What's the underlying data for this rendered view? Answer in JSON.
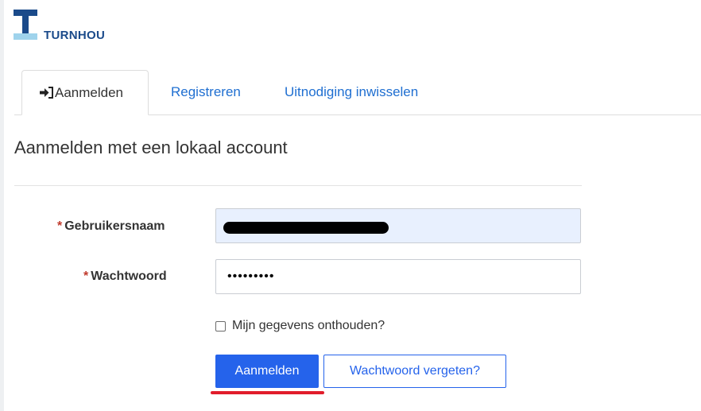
{
  "header": {
    "logo_text": "TURNHOU"
  },
  "tabs": [
    {
      "label": "Aanmelden",
      "icon": "sign-in-icon",
      "active": true
    },
    {
      "label": "Registreren",
      "active": false
    },
    {
      "label": "Uitnodiging inwisselen",
      "active": false
    }
  ],
  "form": {
    "title": "Aanmelden met een lokaal account",
    "required_marker": "*",
    "username_label": "Gebruikersnaam",
    "username_value": "",
    "password_label": "Wachtwoord",
    "password_value": "•••••••••",
    "remember_label": "Mijn gegevens onthouden?",
    "remember_checked": false,
    "submit_label": "Aanmelden",
    "forgot_label": "Wachtwoord vergeten?"
  },
  "colors": {
    "accent": "#2563eb",
    "link": "#1f6fd1",
    "required": "#c0392b",
    "highlight_underline": "#e11d2b",
    "autofill_bg": "#e8f0fe",
    "logo_dark": "#1a4a8a",
    "logo_light": "#9fd3ec"
  }
}
